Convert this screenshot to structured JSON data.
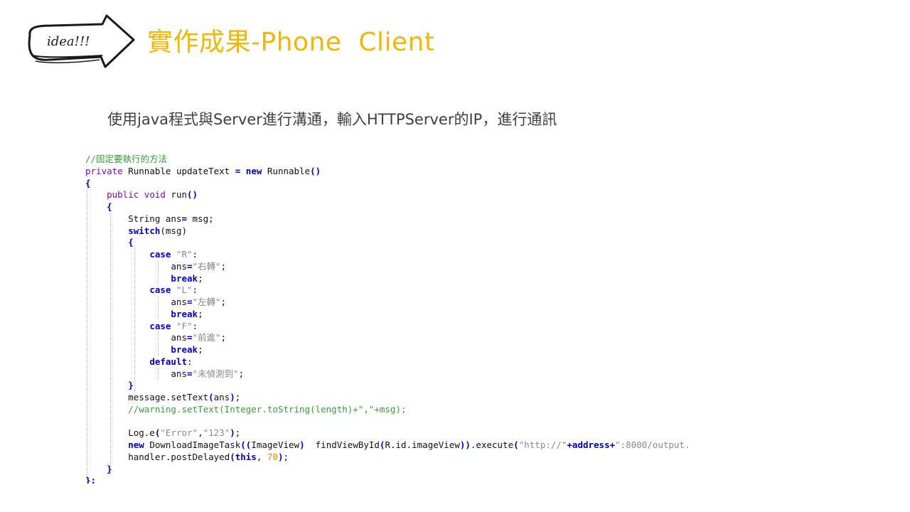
{
  "logo": {
    "text": "idea!!!"
  },
  "slide": {
    "title": "實作成果-Phone  Client",
    "subtitle": "使用java程式與Server進行溝通，輸入HTTPServer的IP，進行通訊"
  },
  "code": {
    "lines": [
      [
        {
          "t": "//固定要執行的方法",
          "c": "cmt"
        }
      ],
      [
        {
          "t": "private",
          "c": "kw2"
        },
        {
          "t": " Runnable updateText ",
          "c": "plain"
        },
        {
          "t": "=",
          "c": "kw"
        },
        {
          "t": " ",
          "c": "plain"
        },
        {
          "t": "new",
          "c": "kw"
        },
        {
          "t": " Runnable",
          "c": "plain"
        },
        {
          "t": "()",
          "c": "kw"
        }
      ],
      [
        {
          "t": "{",
          "c": "kw"
        }
      ],
      [
        {
          "t": "    ",
          "c": "plain"
        },
        {
          "t": "public",
          "c": "kw2"
        },
        {
          "t": " ",
          "c": "plain"
        },
        {
          "t": "void",
          "c": "kw2"
        },
        {
          "t": " run",
          "c": "plain"
        },
        {
          "t": "()",
          "c": "kw"
        }
      ],
      [
        {
          "t": "    ",
          "c": "plain"
        },
        {
          "t": "{",
          "c": "kw"
        }
      ],
      [
        {
          "t": "        String ans",
          "c": "plain"
        },
        {
          "t": "=",
          "c": "kw"
        },
        {
          "t": " msg;",
          "c": "plain"
        }
      ],
      [
        {
          "t": "        ",
          "c": "plain"
        },
        {
          "t": "switch",
          "c": "kw"
        },
        {
          "t": "(msg)",
          "c": "plain"
        }
      ],
      [
        {
          "t": "        ",
          "c": "plain"
        },
        {
          "t": "{",
          "c": "kw"
        }
      ],
      [
        {
          "t": "            ",
          "c": "plain"
        },
        {
          "t": "case",
          "c": "kw"
        },
        {
          "t": " ",
          "c": "plain"
        },
        {
          "t": "\"R\"",
          "c": "str"
        },
        {
          "t": ":",
          "c": "plain"
        }
      ],
      [
        {
          "t": "                ans",
          "c": "plain"
        },
        {
          "t": "=",
          "c": "kw"
        },
        {
          "t": "\"右轉\"",
          "c": "str"
        },
        {
          "t": ";",
          "c": "plain"
        }
      ],
      [
        {
          "t": "                ",
          "c": "plain"
        },
        {
          "t": "break",
          "c": "kw"
        },
        {
          "t": ";",
          "c": "plain"
        }
      ],
      [
        {
          "t": "            ",
          "c": "plain"
        },
        {
          "t": "case",
          "c": "kw"
        },
        {
          "t": " ",
          "c": "plain"
        },
        {
          "t": "\"L\"",
          "c": "str"
        },
        {
          "t": ":",
          "c": "plain"
        }
      ],
      [
        {
          "t": "                ans",
          "c": "plain"
        },
        {
          "t": "=",
          "c": "kw"
        },
        {
          "t": "\"左轉\"",
          "c": "str"
        },
        {
          "t": ";",
          "c": "plain"
        }
      ],
      [
        {
          "t": "                ",
          "c": "plain"
        },
        {
          "t": "break",
          "c": "kw"
        },
        {
          "t": ";",
          "c": "plain"
        }
      ],
      [
        {
          "t": "            ",
          "c": "plain"
        },
        {
          "t": "case",
          "c": "kw"
        },
        {
          "t": " ",
          "c": "plain"
        },
        {
          "t": "\"F\"",
          "c": "str"
        },
        {
          "t": ":",
          "c": "plain"
        }
      ],
      [
        {
          "t": "                ans",
          "c": "plain"
        },
        {
          "t": "=",
          "c": "kw"
        },
        {
          "t": "\"前進\"",
          "c": "str"
        },
        {
          "t": ";",
          "c": "plain"
        }
      ],
      [
        {
          "t": "                ",
          "c": "plain"
        },
        {
          "t": "break",
          "c": "kw"
        },
        {
          "t": ";",
          "c": "plain"
        }
      ],
      [
        {
          "t": "            ",
          "c": "plain"
        },
        {
          "t": "default",
          "c": "kw"
        },
        {
          "t": ":",
          "c": "plain"
        }
      ],
      [
        {
          "t": "                ans",
          "c": "plain"
        },
        {
          "t": "=",
          "c": "kw"
        },
        {
          "t": "\"未偵測到\"",
          "c": "str"
        },
        {
          "t": ";",
          "c": "plain"
        }
      ],
      [
        {
          "t": "        ",
          "c": "plain"
        },
        {
          "t": "}",
          "c": "kw"
        }
      ],
      [
        {
          "t": "        message.setText",
          "c": "plain"
        },
        {
          "t": "(",
          "c": "kw"
        },
        {
          "t": "ans",
          "c": "plain"
        },
        {
          "t": ")",
          "c": "kw"
        },
        {
          "t": ";",
          "c": "plain"
        }
      ],
      [
        {
          "t": "        //warning.setText(Integer.toString(length)+\",\"+msg);",
          "c": "cmt"
        }
      ],
      [],
      [
        {
          "t": "        Log.e",
          "c": "plain"
        },
        {
          "t": "(",
          "c": "kw"
        },
        {
          "t": "\"Error\"",
          "c": "str"
        },
        {
          "t": ",",
          "c": "plain"
        },
        {
          "t": "\"123\"",
          "c": "str"
        },
        {
          "t": ")",
          "c": "kw"
        },
        {
          "t": ";",
          "c": "plain"
        }
      ],
      [
        {
          "t": "        ",
          "c": "plain"
        },
        {
          "t": "new",
          "c": "kw"
        },
        {
          "t": " DownloadImageTask",
          "c": "plain"
        },
        {
          "t": "((",
          "c": "kw"
        },
        {
          "t": "ImageView",
          "c": "plain"
        },
        {
          "t": ")",
          "c": "kw"
        },
        {
          "t": "  findViewById",
          "c": "plain"
        },
        {
          "t": "(",
          "c": "kw"
        },
        {
          "t": "R.id.imageView",
          "c": "plain"
        },
        {
          "t": "))",
          "c": "kw"
        },
        {
          "t": ".execute",
          "c": "plain"
        },
        {
          "t": "(",
          "c": "kw"
        },
        {
          "t": "\"http://\"",
          "c": "str"
        },
        {
          "t": "+address+",
          "c": "kw"
        },
        {
          "t": "\":8000/output.",
          "c": "str"
        }
      ],
      [
        {
          "t": "        handler.postDelayed",
          "c": "plain"
        },
        {
          "t": "(",
          "c": "kw"
        },
        {
          "t": "this",
          "c": "kw"
        },
        {
          "t": ", ",
          "c": "plain"
        },
        {
          "t": "70",
          "c": "num"
        },
        {
          "t": ")",
          "c": "kw"
        },
        {
          "t": ";",
          "c": "plain"
        }
      ],
      [
        {
          "t": "    ",
          "c": "plain"
        },
        {
          "t": "}",
          "c": "kw"
        }
      ],
      [
        {
          "t": "};",
          "c": "kw"
        }
      ]
    ]
  }
}
